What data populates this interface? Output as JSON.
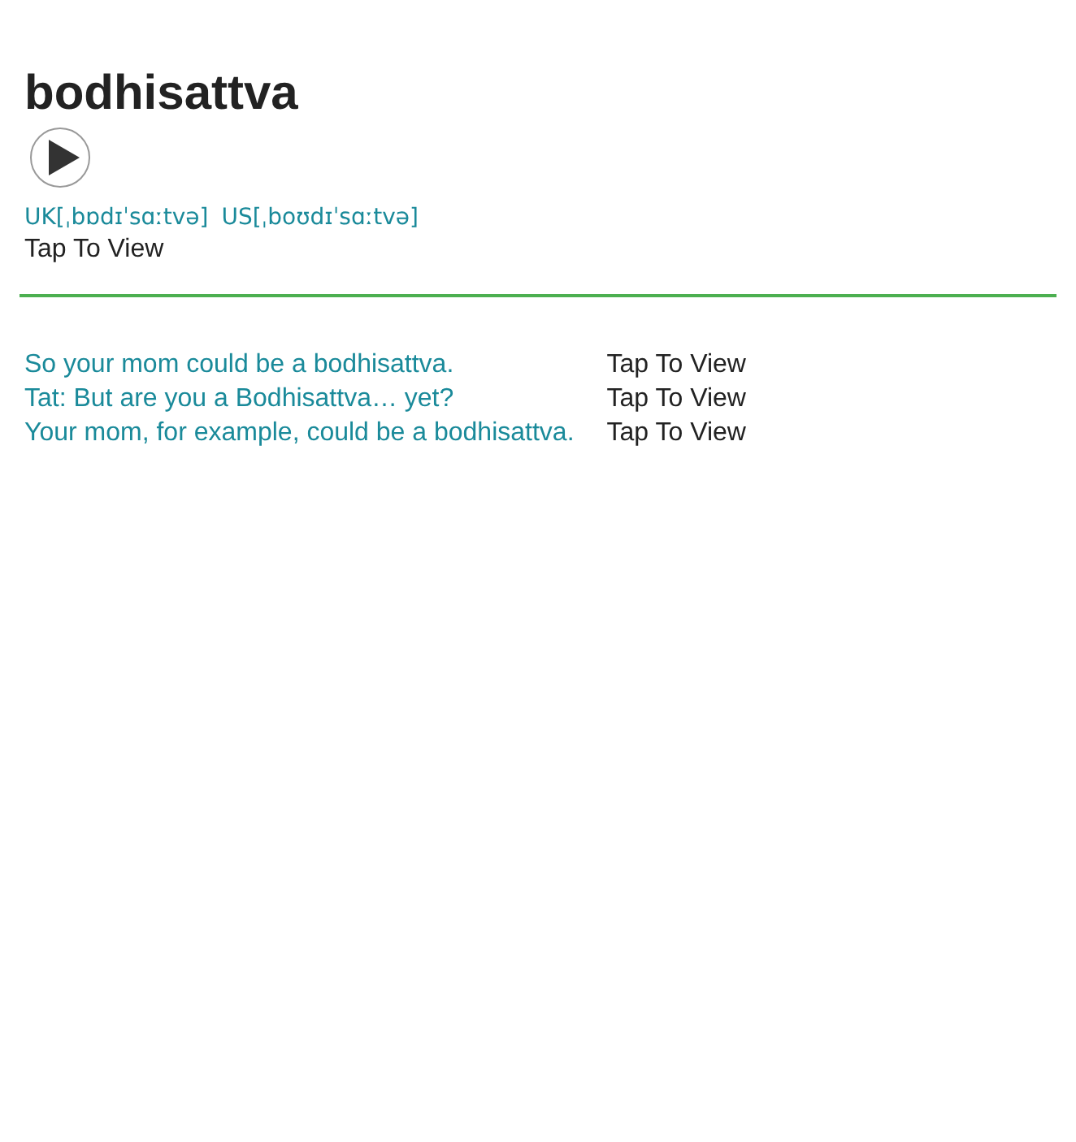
{
  "word": "bodhisattva",
  "pronunciations": [
    "UK[ˌbɒdɪˈsɑːtvə]",
    "US[ˌboʊdɪˈsɑːtvə]"
  ],
  "translation": "Tap To View",
  "examples": [
    {
      "sentence": "So your mom could be a bodhisattva.",
      "translation": "Tap To View"
    },
    {
      "sentence": "Tat: But are you a Bodhisattva… yet?",
      "translation": "Tap To View"
    },
    {
      "sentence": "Your mom, for example, could be a bodhisattva.",
      "translation": "Tap To View"
    }
  ]
}
